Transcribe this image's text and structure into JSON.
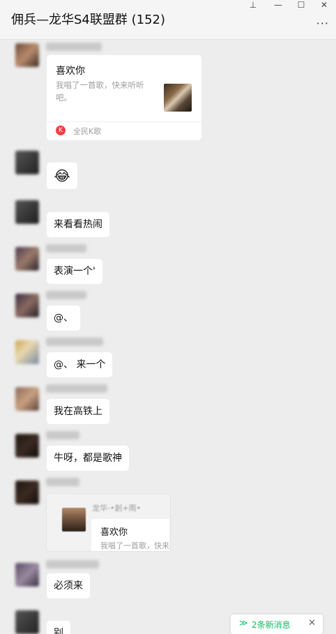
{
  "window": {
    "title": "佣兵—龙华S4联盟群 (152)",
    "controls": {
      "pin": "⊥",
      "minimize": "—",
      "maximize": "☐",
      "close": "✕"
    },
    "more": "···"
  },
  "messages": {
    "m1_card": {
      "title": "喜欢你",
      "description": "我唱了一首歌，快来听听吧。",
      "source": "全民K歌",
      "source_icon": "K"
    },
    "m2_emoji": "😂",
    "m3": "来看看热闹",
    "m4": "表演一个'",
    "m5": "@、",
    "m6": "@、 来一个",
    "m7": "我在高铁上",
    "m8": "牛呀，都是歌神",
    "m9_quote": {
      "name": "龙华-•創+雨•",
      "title": "喜欢你",
      "description": "我唱了一首歌，快来"
    },
    "m10": "必须来",
    "m11": "别"
  },
  "toast": {
    "icon": "≫",
    "text": "2条新消息",
    "close": "✕",
    "accent": "#07c160"
  }
}
